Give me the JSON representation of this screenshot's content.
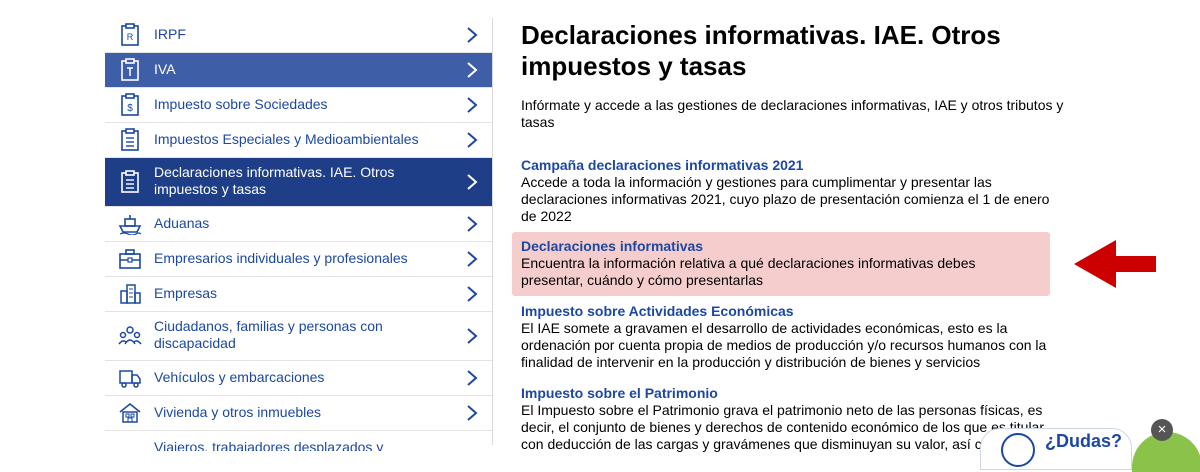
{
  "sidebar": {
    "items": [
      {
        "label": "IRPF",
        "icon": "irpf-document-icon"
      },
      {
        "label": "IVA",
        "icon": "iva-document-icon"
      },
      {
        "label": "Impuesto sobre Sociedades",
        "icon": "sociedades-document-icon"
      },
      {
        "label": "Impuestos Especiales y Medioambientales",
        "icon": "especiales-document-icon"
      },
      {
        "label": "Declaraciones informativas. IAE. Otros impuestos y tasas",
        "icon": "declaraciones-document-icon"
      },
      {
        "label": "Aduanas",
        "icon": "ship-icon"
      },
      {
        "label": "Empresarios individuales y profesionales",
        "icon": "briefcase-icon"
      },
      {
        "label": "Empresas",
        "icon": "buildings-icon"
      },
      {
        "label": "Ciudadanos, familias y personas con discapacidad",
        "icon": "people-icon"
      },
      {
        "label": "Vehículos y embarcaciones",
        "icon": "vehicle-icon"
      },
      {
        "label": "Vivienda y otros inmuebles",
        "icon": "house-icon"
      },
      {
        "label": "Viajeros, trabajadores desplazados y",
        "icon": "traveler-icon"
      }
    ]
  },
  "main": {
    "title": "Declaraciones informativas. IAE. Otros impuestos y tasas",
    "intro": "Infórmate y accede a las gestiones de declaraciones informativas, IAE y otros tributos y tasas",
    "entries": [
      {
        "title": "Campaña declaraciones informativas 2021",
        "desc": "Accede a toda la información y gestiones para cumplimentar y presentar las declaraciones informativas 2021, cuyo plazo de presentación comienza el 1 de enero de 2022"
      },
      {
        "title": "Declaraciones informativas",
        "desc": "Encuentra la información relativa a qué declaraciones informativas debes presentar, cuándo y cómo presentarlas"
      },
      {
        "title": "Impuesto sobre Actividades Económicas",
        "desc": "El IAE somete a gravamen el desarrollo de actividades económicas, esto es la ordenación por cuenta propia de medios de producción y/o recursos humanos con la finalidad de intervenir en la producción y distribución de bienes y servicios"
      },
      {
        "title": "Impuesto sobre el Patrimonio",
        "desc": "El Impuesto sobre el Patrimonio grava el patrimonio neto de las personas físicas, es decir, el conjunto de bienes y derechos de contenido económico de los que es titular, con deducción de las cargas y gravámenes que disminuyan su valor, así como"
      }
    ]
  },
  "help": {
    "label": "¿Dudas?",
    "close": "×"
  },
  "colors": {
    "link": "#1c48a3",
    "active_bg": "#1e3f87",
    "hover_bg": "#3f5ea8",
    "highlight_bg": "#f5cdcd",
    "arrow": "#cc0000"
  }
}
